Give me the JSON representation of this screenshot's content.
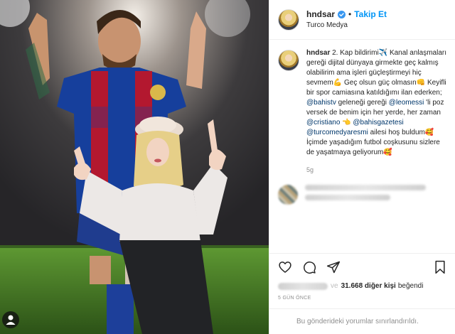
{
  "post": {
    "image_alt": "Photo of a woman posing in front of a painted football player mural"
  },
  "header": {
    "username": "hndsar",
    "separator": "•",
    "follow_label": "Takip Et",
    "location": "Turco Medya"
  },
  "caption": {
    "username": "hndsar",
    "segments": [
      {
        "t": "2. Kap bildirimi",
        "m": false
      },
      {
        "t": "✈️",
        "m": false
      },
      {
        "t": " Kanal anlaşmaları gereği dijital dünyaya girmekte geç kalmış olabilirim ama işleri güçleştirmeyi hiç sevmem",
        "m": false
      },
      {
        "t": "💪",
        "m": false
      },
      {
        "t": " Geç olsun güç olmasın",
        "m": false
      },
      {
        "t": "👊",
        "m": false
      },
      {
        "t": " Keyifli bir spor camiasına katıldığımı ilan ederken; ",
        "m": false
      },
      {
        "t": "@bahistv",
        "m": true
      },
      {
        "t": " geleneği gereği ",
        "m": false
      },
      {
        "t": "@leomessi",
        "m": true
      },
      {
        "t": " 'li poz versek de benim için her yerde, her zaman ",
        "m": false
      },
      {
        "t": "@cristiano",
        "m": true
      },
      {
        "t": " 👈 ",
        "m": false
      },
      {
        "t": "@bahisgazetesi",
        "m": true
      },
      {
        "t": " ",
        "m": false
      },
      {
        "t": "@turcomedyaresmi",
        "m": true
      },
      {
        "t": " ailesi hoş buldum",
        "m": false
      },
      {
        "t": "🥰",
        "m": false
      },
      {
        "t": " İçimde yaşadığım futbol coşkusunu sizlere de yaşatmaya geliyorum",
        "m": false
      },
      {
        "t": "🥰",
        "m": false
      }
    ],
    "ago": "5g"
  },
  "actions": {
    "like_icon": "heart-icon",
    "comment_icon": "comment-icon",
    "share_icon": "share-icon",
    "save_icon": "bookmark-icon",
    "like_connector": "ve",
    "like_count": "31.668 diğer kişi",
    "like_suffix": "beğendi",
    "date": "5 gün önce"
  },
  "footer": {
    "text": "Bu gönderideki yorumlar sınırlandırıldı."
  },
  "colors": {
    "accent": "#0095f6",
    "mention": "#00376b",
    "muted": "#8e8e8e"
  }
}
